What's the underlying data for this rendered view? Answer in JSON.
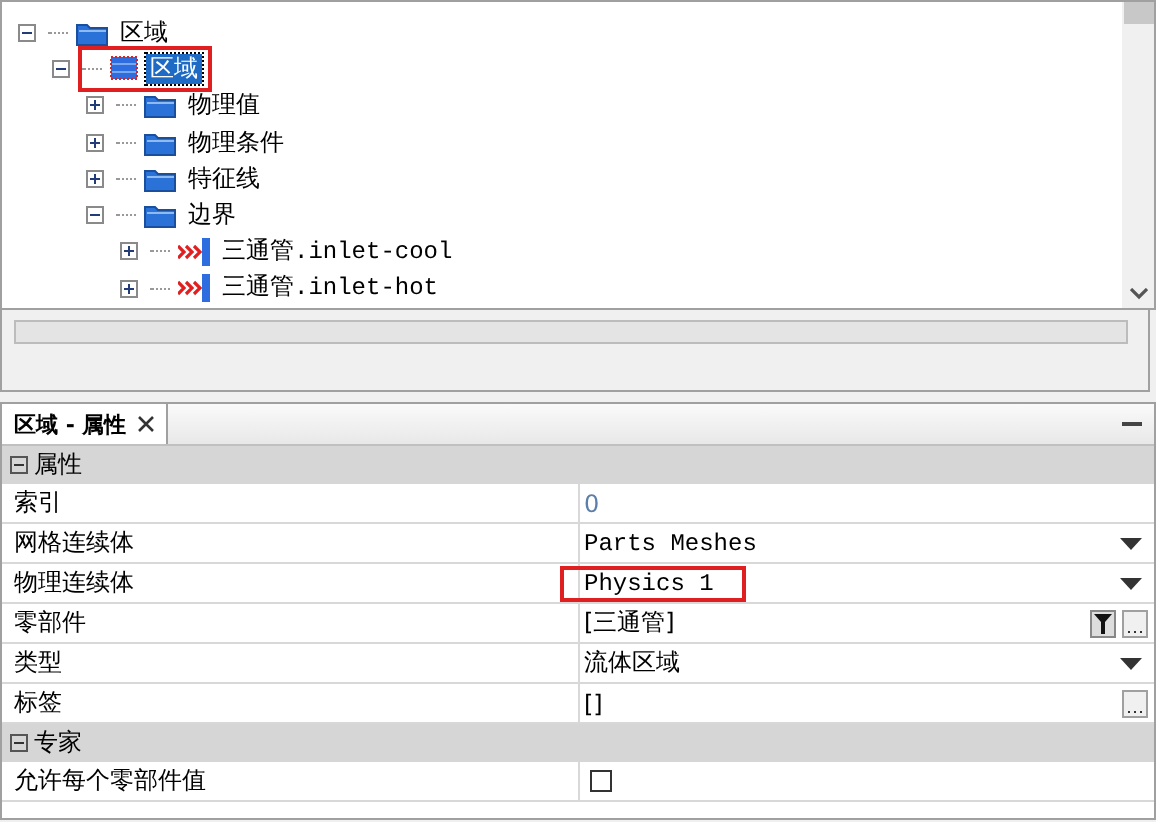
{
  "tree": [
    {
      "label": "区域",
      "kind": "folder",
      "expanded": true,
      "selected": false,
      "highlighted": false,
      "children": [
        {
          "label": "区域",
          "kind": "region",
          "expanded": true,
          "selected": true,
          "highlighted": true,
          "children": [
            {
              "label": "物理值",
              "kind": "folder",
              "expanded": false,
              "selected": false,
              "highlighted": false
            },
            {
              "label": "物理条件",
              "kind": "folder",
              "expanded": false,
              "selected": false,
              "highlighted": false
            },
            {
              "label": "特征线",
              "kind": "folder",
              "expanded": false,
              "selected": false,
              "highlighted": false
            },
            {
              "label": "边界",
              "kind": "folder",
              "expanded": true,
              "selected": false,
              "highlighted": false,
              "children": [
                {
                  "label": "三通管.inlet-cool",
                  "kind": "inlet",
                  "expanded": false,
                  "selected": false,
                  "highlighted": false
                },
                {
                  "label": "三通管.inlet-hot",
                  "kind": "inlet",
                  "expanded": false,
                  "selected": false,
                  "highlighted": false
                }
              ]
            }
          ]
        }
      ]
    }
  ],
  "properties_panel": {
    "tab": {
      "label": "区域 - 属性",
      "selected": true
    },
    "rows": [
      {
        "kind": "group",
        "label": "属性",
        "expanded": true
      },
      {
        "kind": "text",
        "label": "索引",
        "value": "0",
        "highlighted": false
      },
      {
        "kind": "dropdown",
        "label": "网格连续体",
        "value": "Parts Meshes",
        "highlighted": false
      },
      {
        "kind": "dropdown",
        "label": "物理连续体",
        "value": "Physics 1",
        "highlighted": true
      },
      {
        "kind": "filter",
        "label": "零部件",
        "value": "[三通管]",
        "highlighted": false
      },
      {
        "kind": "dropdown",
        "label": "类型",
        "value": "流体区域",
        "highlighted": false
      },
      {
        "kind": "ellipsis",
        "label": "标签",
        "value": "[]",
        "highlighted": false
      },
      {
        "kind": "group",
        "label": "专家",
        "expanded": true
      },
      {
        "kind": "checkbox",
        "label": "允许每个零部件值",
        "checked": false
      }
    ]
  }
}
